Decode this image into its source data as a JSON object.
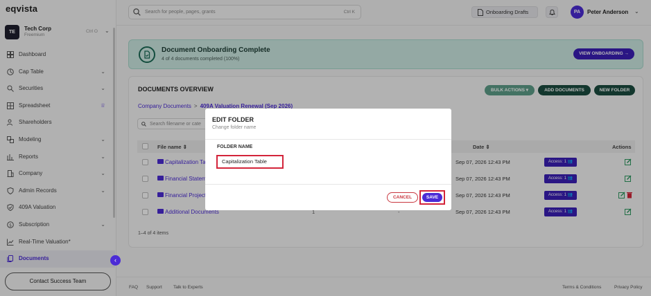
{
  "app": {
    "logo": "eqvista"
  },
  "org": {
    "initials": "TE",
    "name": "Tech Corp",
    "plan": "Freemium",
    "shortcut": "Ctrl O"
  },
  "sidebar": {
    "items": [
      {
        "label": "Dashboard",
        "icon": "dashboard-icon",
        "chevron": false
      },
      {
        "label": "Cap Table",
        "icon": "cap-table-icon",
        "chevron": true
      },
      {
        "label": "Securities",
        "icon": "securities-icon",
        "chevron": true
      },
      {
        "label": "Spreadsheet",
        "icon": "spreadsheet-icon",
        "crown": true
      },
      {
        "label": "Shareholders",
        "icon": "shareholders-icon",
        "chevron": false
      },
      {
        "label": "Modeling",
        "icon": "modeling-icon",
        "chevron": true
      },
      {
        "label": "Reports",
        "icon": "reports-icon",
        "chevron": true
      },
      {
        "label": "Company",
        "icon": "company-icon",
        "chevron": true
      },
      {
        "label": "Admin Records",
        "icon": "admin-records-icon",
        "chevron": true
      },
      {
        "label": "409A Valuation",
        "icon": "valuation-icon",
        "chevron": false
      },
      {
        "label": "Subscription",
        "icon": "subscription-icon",
        "chevron": true
      },
      {
        "label": "Real-Time Valuation*",
        "icon": "chart-icon",
        "chevron": false
      },
      {
        "label": "Documents",
        "icon": "documents-icon",
        "chevron": false,
        "active": true
      }
    ],
    "contact": "Contact Success Team"
  },
  "topbar": {
    "search_placeholder": "Search for people, pages, grants",
    "search_shortcut": "Ctrl K",
    "drafts": "Onboarding Drafts",
    "user_initials": "PA",
    "user_name": "Peter Anderson"
  },
  "banner": {
    "title": "Document Onboarding Complete",
    "subtitle": "4 of 4 documents completed (100%)",
    "button": "VIEW ONBOARDING →"
  },
  "docs": {
    "title": "DOCUMENTS OVERVIEW",
    "bulk": "BULK ACTIONS ▾",
    "add": "ADD DOCUMENTS",
    "new_folder": "NEW FOLDER",
    "breadcrumb": {
      "root": "Company Documents",
      "sep": ">",
      "current": "409A Valuation Renewal (Sep 2026)"
    },
    "search_placeholder": "Search filename or cate",
    "columns": {
      "file": "File name ⇕",
      "date": "Date ⇕",
      "actions": "Actions"
    },
    "rows": [
      {
        "name": "Capitalization Ta",
        "c1": "",
        "c2": "",
        "date": "Sep 07, 2026 12:43 PM",
        "access": "Access: 1 👥",
        "delete": false
      },
      {
        "name": "Financial Statem",
        "c1": "",
        "c2": "",
        "date": "Sep 07, 2026 12:43 PM",
        "access": "Access: 1 👥",
        "delete": false
      },
      {
        "name": "Financial Project",
        "c1": "",
        "c2": "",
        "date": "Sep 07, 2026 12:43 PM",
        "access": "Access: 1 👥",
        "delete": true
      },
      {
        "name": "Additional Documents",
        "c1": "1",
        "c2": "-",
        "date": "Sep 07, 2026 12:43 PM",
        "access": "Access: 1 👥",
        "delete": false
      }
    ],
    "pager": "1–4 of 4 items"
  },
  "footer": {
    "faq": "FAQ",
    "support": "Support",
    "experts": "Talk to Experts",
    "terms": "Terms & Conditions",
    "privacy": "Privacy Policy"
  },
  "modal": {
    "title": "EDIT FOLDER",
    "subtitle": "Change folder name",
    "field_label": "FOLDER NAME",
    "field_value": "Capitalization Table",
    "cancel": "CANCEL",
    "save": "SAVE"
  },
  "colors": {
    "accent": "#4b2bd6",
    "green": "#1b6b57",
    "danger": "#d3243a"
  }
}
